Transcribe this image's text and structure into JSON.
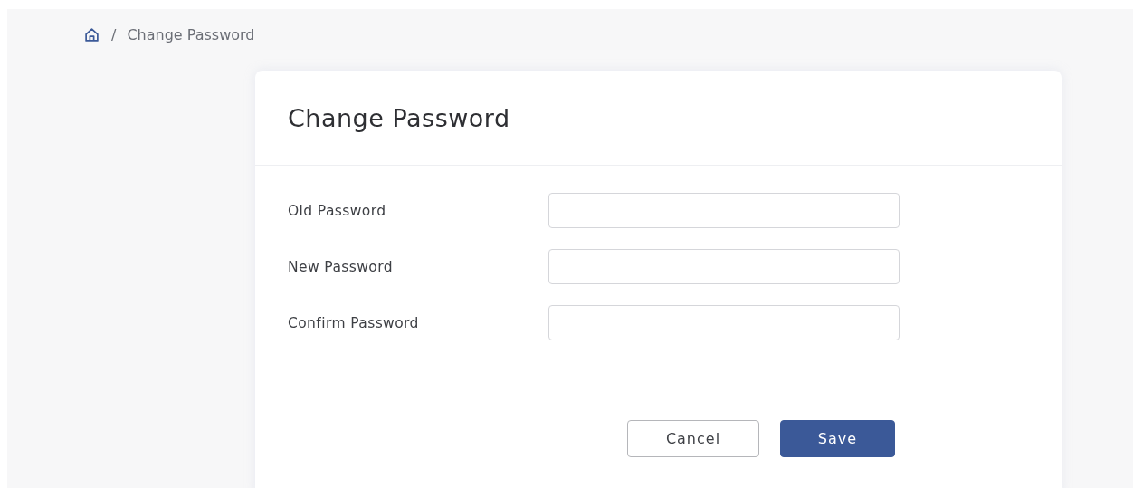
{
  "breadcrumb": {
    "separator": "/",
    "current": "Change Password"
  },
  "card": {
    "title": "Change Password",
    "fields": [
      {
        "label": "Old Password"
      },
      {
        "label": "New Password"
      },
      {
        "label": "Confirm Password"
      }
    ],
    "buttons": [
      {
        "label": "Cancel",
        "kind": "secondary"
      },
      {
        "label": "Save",
        "kind": "primary"
      }
    ]
  }
}
